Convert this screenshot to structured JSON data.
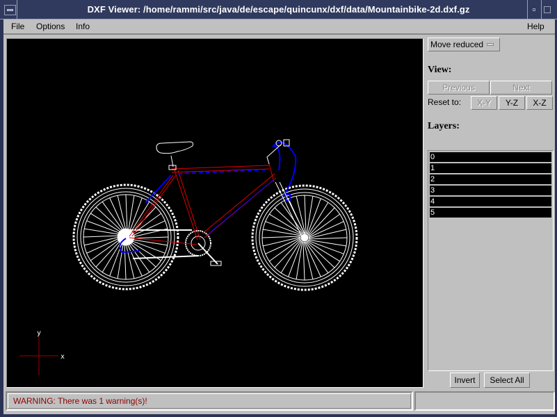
{
  "window": {
    "title": "DXF Viewer: /home/rammi/src/java/de/escape/quincunx/dxf/data/Mountainbike-2d.dxf.gz"
  },
  "menubar": {
    "items": [
      {
        "label": "File"
      },
      {
        "label": "Options"
      },
      {
        "label": "Info"
      }
    ],
    "help": "Help"
  },
  "side": {
    "move_mode": "Move reduced",
    "view_heading": "View:",
    "previous_label": "Previous",
    "next_label": "Next",
    "reset_label": "Reset to:",
    "reset_buttons": [
      "X-Y",
      "Y-Z",
      "X-Z"
    ],
    "layers_heading": "Layers:",
    "layers": [
      "0",
      "1",
      "2",
      "3",
      "4",
      "5"
    ],
    "invert_label": "Invert",
    "select_all_label": "Select All"
  },
  "canvas": {
    "axis_x_label": "x",
    "axis_y_label": "y",
    "colors": {
      "background": "#000000",
      "white": "#ffffff",
      "red": "#e00000",
      "blue": "#0000ff",
      "axis": "#a00000"
    }
  },
  "status": {
    "message": "WARNING: There was 1 warning(s)!",
    "color": "#8b0000"
  }
}
